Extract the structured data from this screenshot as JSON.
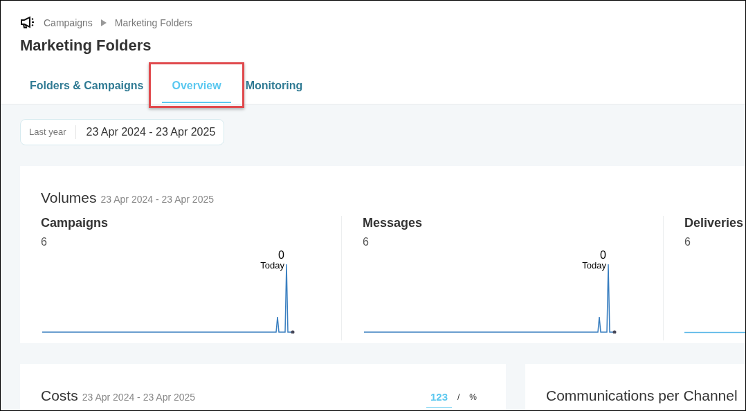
{
  "breadcrumb": [
    "Campaigns",
    "Marketing Folders"
  ],
  "title": "Marketing Folders",
  "tabs": [
    {
      "label": "Folders & Campaigns",
      "selected": false,
      "highlighted": false
    },
    {
      "label": "Overview",
      "selected": true,
      "highlighted": true
    },
    {
      "label": "Monitoring",
      "selected": false,
      "highlighted": false
    }
  ],
  "date_filter": {
    "preset": "Last year",
    "range": "23 Apr 2024 - 23 Apr 2025"
  },
  "volumes": {
    "title": "Volumes",
    "range": "23 Apr 2024 - 23 Apr 2025",
    "metrics": [
      {
        "label": "Campaigns",
        "value": "6",
        "peak_value": "0",
        "peak_label": "Today",
        "kind": "spikes"
      },
      {
        "label": "Messages",
        "value": "6",
        "peak_value": "0",
        "peak_label": "Today",
        "kind": "spikes"
      },
      {
        "label": "Deliveries",
        "value": "6",
        "kind": "flat"
      }
    ]
  },
  "costs": {
    "title": "Costs",
    "range": "23 Apr 2024 - 23 Apr 2025",
    "modes": [
      {
        "label": "123",
        "selected": true
      },
      {
        "label": "%",
        "selected": false
      }
    ],
    "mode_separator": "/"
  },
  "channels": {
    "title": "Communications per Channel"
  }
}
